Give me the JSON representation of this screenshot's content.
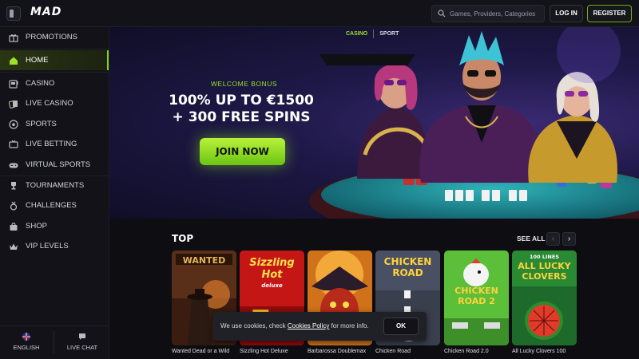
{
  "header": {
    "logo": "MAD",
    "search_placeholder": "Games, Providers, Categories",
    "login_label": "LOG IN",
    "register_label": "REGISTER"
  },
  "sidebar": {
    "items": [
      {
        "label": "PROMOTIONS",
        "icon": "gift-icon"
      },
      {
        "label": "HOME",
        "icon": "home-icon",
        "active": true
      },
      {
        "label": "CASINO",
        "icon": "slot-machine-icon"
      },
      {
        "label": "LIVE CASINO",
        "icon": "cards-icon"
      },
      {
        "label": "SPORTS",
        "icon": "soccer-ball-icon"
      },
      {
        "label": "LIVE BETTING",
        "icon": "tv-icon"
      },
      {
        "label": "VIRTUAL SPORTS",
        "icon": "gamepad-icon"
      },
      {
        "label": "TOURNAMENTS",
        "icon": "trophy-icon"
      },
      {
        "label": "CHALLENGES",
        "icon": "medal-icon"
      },
      {
        "label": "SHOP",
        "icon": "shop-bag-icon"
      },
      {
        "label": "VIP LEVELS",
        "icon": "crown-icon"
      }
    ],
    "footer": {
      "language_label": "ENGLISH",
      "chat_label": "LIVE CHAT"
    }
  },
  "banner": {
    "tabs": [
      "CASINO",
      "SPORT"
    ],
    "active_tab": "CASINO",
    "welcome": "WELCOME BONUS",
    "headline_line1": "100% UP TO €1500",
    "headline_line2": "+ 300 FREE SPINS",
    "cta_label": "JOIN NOW"
  },
  "top_section": {
    "title": "TOP",
    "see_all_label": "SEE ALL",
    "games": [
      {
        "title": "Wanted Dead or a Wild",
        "art_text": "WANTED"
      },
      {
        "title": "Sizzling Hot Deluxe",
        "art_text": "Sizzling Hot",
        "art_sub": "deluxe"
      },
      {
        "title": "Barbarossa Doublemax",
        "art_text": ""
      },
      {
        "title": "Chicken Road",
        "art_text": "CHICKEN ROAD"
      },
      {
        "title": "Chicken Road 2.0",
        "art_text": "CHICKEN ROAD 2"
      },
      {
        "title": "All Lucky Clovers 100",
        "art_text": "ALL LUCKY CLOVERS",
        "art_sub": "100 LINES"
      }
    ]
  },
  "cookie": {
    "text_before": "We use cookies, check ",
    "link": "Cookies Policy",
    "text_after": " for more info.",
    "ok_label": "OK"
  },
  "colors": {
    "accent": "#8bd11f",
    "background": "#0d0d12",
    "sidebar": "#121218"
  }
}
